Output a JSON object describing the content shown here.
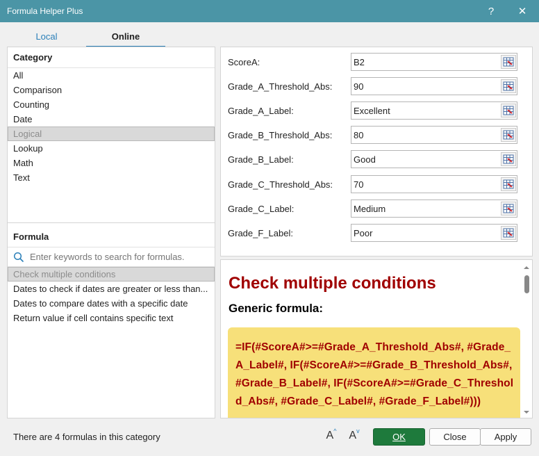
{
  "window": {
    "title": "Formula Helper Plus",
    "help_glyph": "?",
    "close_glyph": "✕"
  },
  "tabs": [
    {
      "label": "Local",
      "active": false
    },
    {
      "label": "Online",
      "active": true
    }
  ],
  "category": {
    "heading": "Category",
    "items": [
      "All",
      "Comparison",
      "Counting",
      "Date",
      "Logical",
      "Lookup",
      "Math",
      "Text"
    ],
    "selected": "Logical"
  },
  "formula": {
    "heading": "Formula",
    "search_placeholder": "Enter keywords to search for formulas.",
    "items": [
      "Check multiple conditions",
      "Dates to check if dates are greater or less than...",
      "Dates to compare dates with a specific date",
      "Return value if cell contains specific text"
    ],
    "selected": "Check multiple conditions"
  },
  "params": [
    {
      "label": "ScoreA:",
      "value": "B2"
    },
    {
      "label": "Grade_A_Threshold_Abs:",
      "value": "90"
    },
    {
      "label": "Grade_A_Label:",
      "value": "Excellent"
    },
    {
      "label": "Grade_B_Threshold_Abs:",
      "value": "80"
    },
    {
      "label": "Grade_B_Label:",
      "value": "Good"
    },
    {
      "label": "Grade_C_Threshold_Abs:",
      "value": "70"
    },
    {
      "label": "Grade_C_Label:",
      "value": "Medium"
    },
    {
      "label": "Grade_F_Label:",
      "value": "Poor"
    }
  ],
  "doc": {
    "title": "Check multiple conditions",
    "subtitle": "Generic formula:",
    "code": "=IF(#ScoreA#>=#Grade_A_Threshold_Abs#, #Grade_A_Label#, IF(#ScoreA#>=#Grade_B_Threshold_Abs#, #Grade_B_Label#, IF(#ScoreA#>=#Grade_C_Threshold_Abs#, #Grade_C_Label#, #Grade_F_Label#)))"
  },
  "footer": {
    "status": "There are 4 formulas in this category",
    "increase_font_glyph": "A",
    "decrease_font_glyph": "A",
    "ok_label": "OK",
    "close_label": "Close",
    "apply_label": "Apply"
  },
  "colors": {
    "titlebar": "#4b95a6",
    "accent": "#2a7fb8",
    "ok_button": "#1e7a3c",
    "doc_title": "#a00000",
    "code_background": "#f7e07a"
  }
}
